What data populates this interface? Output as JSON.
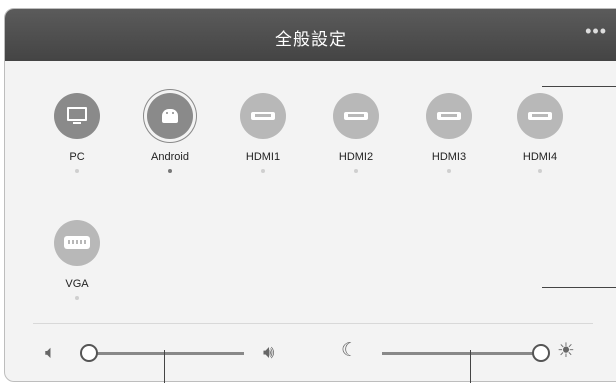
{
  "window": {
    "title": "全般設定",
    "more_icon": "more-horizontal-icon"
  },
  "sources": [
    {
      "label": "PC",
      "icon": "monitor-icon",
      "selected": false
    },
    {
      "label": "Android",
      "icon": "android-icon",
      "selected": true
    },
    {
      "label": "HDMI1",
      "icon": "hdmi-icon",
      "selected": false
    },
    {
      "label": "HDMI2",
      "icon": "hdmi-icon",
      "selected": false
    },
    {
      "label": "HDMI3",
      "icon": "hdmi-icon",
      "selected": false
    },
    {
      "label": "HDMI4",
      "icon": "hdmi-icon",
      "selected": false
    },
    {
      "label": "VGA",
      "icon": "vga-icon",
      "selected": false
    }
  ],
  "volume": {
    "value": 0,
    "min_icon": "volume-mute-icon",
    "max_icon": "volume-up-icon"
  },
  "brightness": {
    "value": 1,
    "min_icon": "moon-icon",
    "max_icon": "sun-icon"
  }
}
